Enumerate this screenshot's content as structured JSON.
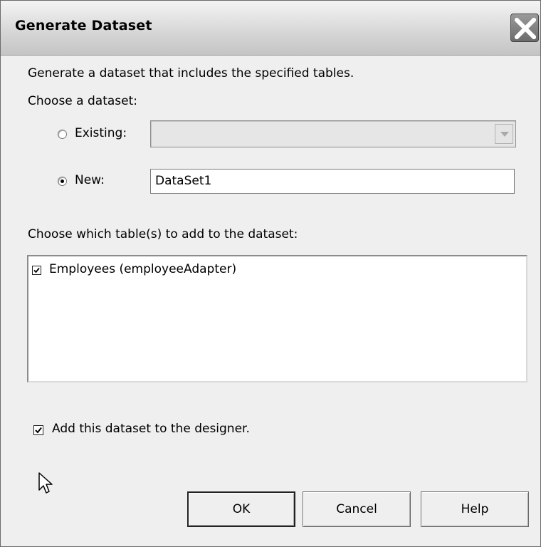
{
  "dialog": {
    "title": "Generate Dataset",
    "intro": "Generate a dataset that includes the specified tables.",
    "choose_dataset_label": "Choose a dataset:",
    "existing": {
      "label": "Existing:",
      "selected": false,
      "value": ""
    },
    "new": {
      "label": "New:",
      "selected": true,
      "value": "DataSet1"
    },
    "tables_label": "Choose which table(s) to add to the dataset:",
    "tables": [
      {
        "label": "Employees (employeeAdapter)",
        "checked": true
      }
    ],
    "add_to_designer": {
      "label": "Add this dataset to the designer.",
      "checked": true
    },
    "buttons": {
      "ok": "OK",
      "cancel": "Cancel",
      "help": "Help"
    }
  },
  "icons": [
    "close-icon",
    "dropdown-arrow-icon",
    "checkmark-icon",
    "mouse-pointer-icon"
  ]
}
